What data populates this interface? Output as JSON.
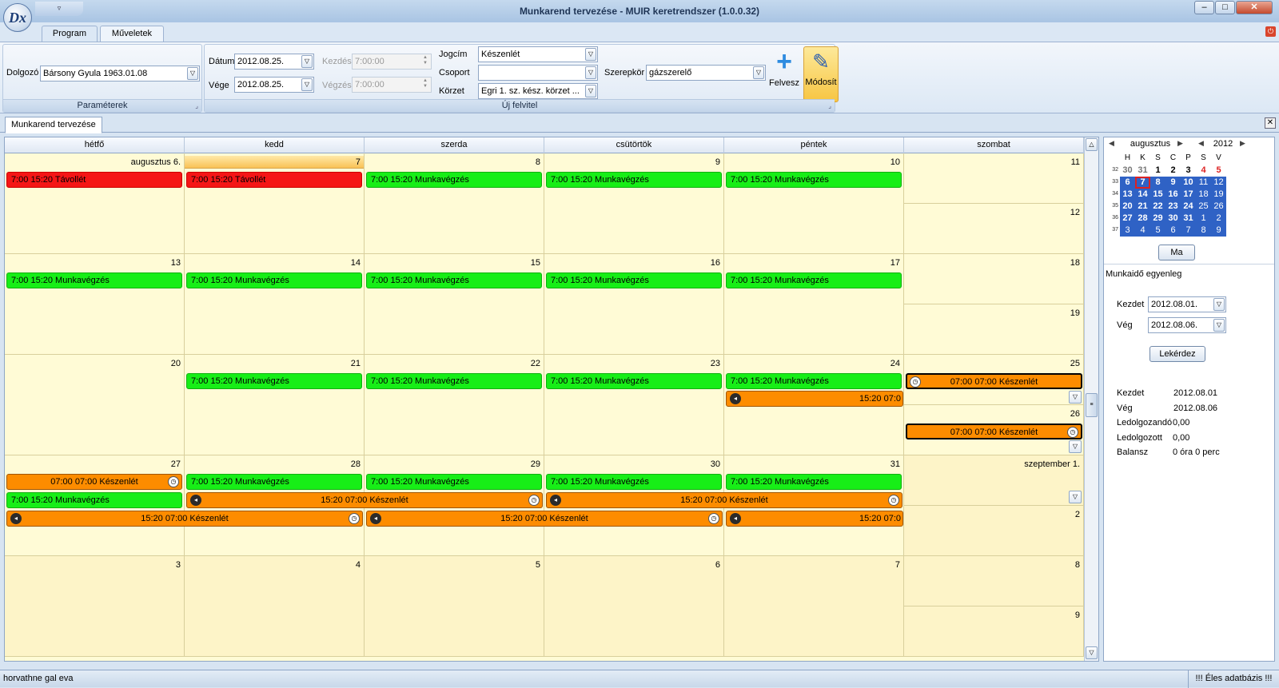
{
  "window": {
    "title": "Munkarend tervezése - MUIR keretrendszer (1.0.0.32)",
    "app_logo": "Dx"
  },
  "ribbon_tabs": [
    {
      "label": "Program"
    },
    {
      "label": "Műveletek"
    }
  ],
  "params": {
    "dolgozo_label": "Dolgozó",
    "dolgozo_value": "Bársony Gyula 1963.01.08",
    "group_caption": "Paraméterek"
  },
  "uj_felvitel": {
    "datum_label": "Dátum",
    "datum_value": "2012.08.25.",
    "vege_label": "Vége",
    "vege_value": "2012.08.25.",
    "kezdes_label": "Kezdés",
    "kezdes_value": "7:00:00",
    "vegzes_label": "Végzés",
    "vegzes_value": "7:00:00",
    "jogcim_label": "Jogcím",
    "jogcim_value": "Készenlét",
    "csoport_label": "Csoport",
    "csoport_value": "",
    "korzet_label": "Körzet",
    "korzet_value": "Egri 1. sz. kész. körzet ...",
    "szerepkor_label": "Szerepkör",
    "szerepkor_value": "gázszerelő",
    "felvesz_label": "Felvesz",
    "modosit_label": "Módosít",
    "group_caption": "Új felvitel"
  },
  "doc_tab": {
    "label": "Munkarend tervezése"
  },
  "calendar": {
    "day_headers": [
      "hétfő",
      "kedd",
      "szerda",
      "csütörtök",
      "péntek",
      "szombat"
    ],
    "weeks": [
      {
        "days": [
          "augusztus 6.",
          "7",
          "8",
          "9",
          "10"
        ],
        "sat": "11",
        "sun": "12"
      },
      {
        "days": [
          "13",
          "14",
          "15",
          "16",
          "17"
        ],
        "sat": "18",
        "sun": "19"
      },
      {
        "days": [
          "20",
          "21",
          "22",
          "23",
          "24"
        ],
        "sat": "25",
        "sun": "26"
      },
      {
        "days": [
          "27",
          "28",
          "29",
          "30",
          "31"
        ],
        "sat": "szeptember 1.",
        "sun": "2"
      },
      {
        "days": [
          "3",
          "4",
          "5",
          "6",
          "7"
        ],
        "sat": "8",
        "sun": "9"
      }
    ],
    "events": {
      "w1": [
        "7:00  15:20  Távollét",
        "7:00  15:20  Távollét",
        "7:00  15:20  Munkavégzés",
        "7:00  15:20  Munkavégzés",
        "7:00  15:20  Munkavégzés"
      ],
      "w2": [
        "7:00  15:20  Munkavégzés",
        "7:00  15:20  Munkavégzés",
        "7:00  15:20  Munkavégzés",
        "7:00  15:20  Munkavégzés",
        "7:00  15:20  Munkavégzés"
      ],
      "w3": [
        "7:00  15:20  Munkavégzés",
        "7:00  15:20  Munkavégzés",
        "7:00  15:20  Munkavégzés",
        "7:00  15:20  Munkavégzés"
      ],
      "w3_fri_oncall": "15:20 07:0",
      "w3_sat": "07:00 07:00 Készenlét",
      "w3_sun": "07:00 07:00 Készenlét",
      "w4_mon_oncall": "07:00 07:00 Készenlét",
      "w4_work": [
        "7:00  15:20  Munkavégzés",
        "7:00  15:20  Munkavégzés",
        "7:00  15:20  Munkavégzés",
        "7:00  15:20  Munkavégzés",
        "7:00  15:20  Munkavégzés"
      ],
      "w4_oncall_a": "15:20 07:00 Készenlét",
      "w4_oncall_b": "15:20 07:00 Készenlét",
      "w4_oncall_c": "15:20 07:00 Készenlét",
      "w4_oncall_d": "15:20 07:00 Készenlét",
      "w4_oncall_fri": "15:20 07:0"
    },
    "colors": {
      "work": "#17ee17",
      "absence": "#f51616",
      "oncall": "#fd8c00",
      "bg": "#fffbd6"
    }
  },
  "minical": {
    "month": "augusztus",
    "year": "2012",
    "dow": [
      "H",
      "K",
      "S",
      "C",
      "P",
      "S",
      "V"
    ],
    "weeks": [
      {
        "wk": "32",
        "days": [
          "30",
          "31",
          "1",
          "2",
          "3",
          "4",
          "5"
        ]
      },
      {
        "wk": "33",
        "days": [
          "6",
          "7",
          "8",
          "9",
          "10",
          "11",
          "12"
        ]
      },
      {
        "wk": "34",
        "days": [
          "13",
          "14",
          "15",
          "16",
          "17",
          "18",
          "19"
        ]
      },
      {
        "wk": "35",
        "days": [
          "20",
          "21",
          "22",
          "23",
          "24",
          "25",
          "26"
        ]
      },
      {
        "wk": "36",
        "days": [
          "27",
          "28",
          "29",
          "30",
          "31",
          "1",
          "2"
        ]
      },
      {
        "wk": "37",
        "days": [
          "3",
          "4",
          "5",
          "6",
          "7",
          "8",
          "9"
        ]
      }
    ],
    "today_button": "Ma"
  },
  "balance": {
    "title": "Munkaidő egyenleg",
    "kezdet_label": "Kezdet",
    "kezdet_value": "2012.08.01.",
    "veg_label": "Vég",
    "veg_value": "2012.08.06.",
    "query_button": "Lekérdez",
    "results": [
      {
        "label": "Kezdet",
        "value": "2012.08.01"
      },
      {
        "label": "Vég",
        "value": "2012.08.06"
      },
      {
        "label": "Ledolgozandó",
        "value": "0,00"
      },
      {
        "label": "Ledolgozott",
        "value": "0,00"
      },
      {
        "label": "Balansz",
        "value": "0 óra 0 perc"
      }
    ]
  },
  "status": {
    "user": "horvathne gal eva",
    "env": "!!! Éles adatbázis !!!"
  }
}
